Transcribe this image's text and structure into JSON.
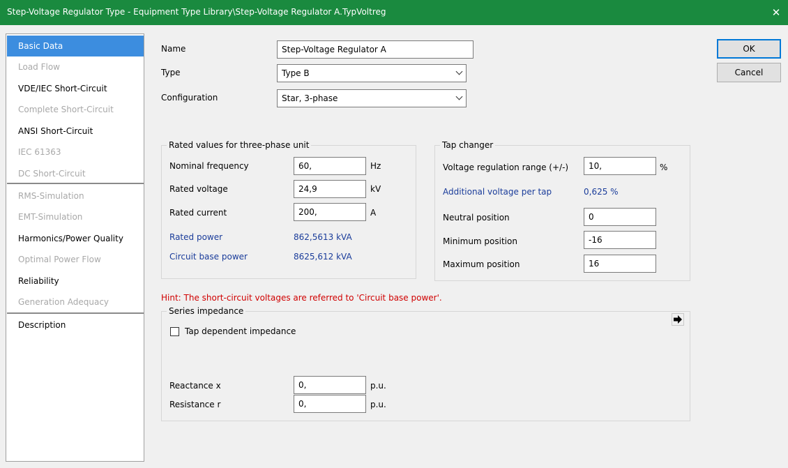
{
  "window": {
    "title": "Step-Voltage Regulator Type - Equipment Type Library\\Step-Voltage Regulator A.TypVoltreg",
    "close_glyph": "✕"
  },
  "nav": {
    "items": [
      {
        "label": "Basic Data",
        "state": "selected"
      },
      {
        "label": "Load Flow",
        "state": "disabled"
      },
      {
        "label": "VDE/IEC Short-Circuit",
        "state": "enabled"
      },
      {
        "label": "Complete Short-Circuit",
        "state": "disabled"
      },
      {
        "label": "ANSI Short-Circuit",
        "state": "enabled"
      },
      {
        "label": "IEC 61363",
        "state": "disabled"
      },
      {
        "label": "DC Short-Circuit",
        "state": "disabled"
      },
      {
        "label": "RMS-Simulation",
        "state": "disabled"
      },
      {
        "label": "EMT-Simulation",
        "state": "disabled"
      },
      {
        "label": "Harmonics/Power Quality",
        "state": "enabled"
      },
      {
        "label": "Optimal Power Flow",
        "state": "disabled"
      },
      {
        "label": "Reliability",
        "state": "enabled"
      },
      {
        "label": "Generation Adequacy",
        "state": "disabled"
      },
      {
        "label": "Description",
        "state": "enabled"
      }
    ]
  },
  "buttons": {
    "ok": "OK",
    "cancel": "Cancel"
  },
  "basic": {
    "name_label": "Name",
    "name_value": "Step-Voltage Regulator A",
    "type_label": "Type",
    "type_value": "Type B",
    "config_label": "Configuration",
    "config_value": "Star, 3-phase"
  },
  "rated": {
    "title": "Rated values for three-phase unit",
    "freq_label": "Nominal frequency",
    "freq_value": "60,",
    "freq_unit": "Hz",
    "voltage_label": "Rated voltage",
    "voltage_value": "24,9",
    "voltage_unit": "kV",
    "current_label": "Rated current",
    "current_value": "200,",
    "current_unit": "A",
    "power_label": "Rated power",
    "power_value": "862,5613 kVA",
    "base_label": "Circuit base power",
    "base_value": "8625,612 kVA"
  },
  "tap": {
    "title": "Tap changer",
    "range_label": "Voltage regulation range (+/-)",
    "range_value": "10,",
    "range_unit": "%",
    "add_label": "Additional voltage per tap",
    "add_value": "0,625 %",
    "neutral_label": "Neutral position",
    "neutral_value": "0",
    "min_label": "Minimum position",
    "min_value": "-16",
    "max_label": "Maximum position",
    "max_value": "16"
  },
  "hint": "Hint: The short-circuit voltages are referred to 'Circuit base power'.",
  "series": {
    "title": "Series impedance",
    "tap_dep_label": "Tap dependent impedance",
    "tap_dep_checked": false,
    "x_label": "Reactance x",
    "x_value": "0,",
    "x_unit": "p.u.",
    "r_label": "Resistance r",
    "r_value": "0,",
    "r_unit": "p.u."
  },
  "colors": {
    "titlebar": "#1a8a3f",
    "nav_selected": "#3c8ddf",
    "blue_text": "#1a3c9a",
    "hint_red": "#d00000"
  }
}
